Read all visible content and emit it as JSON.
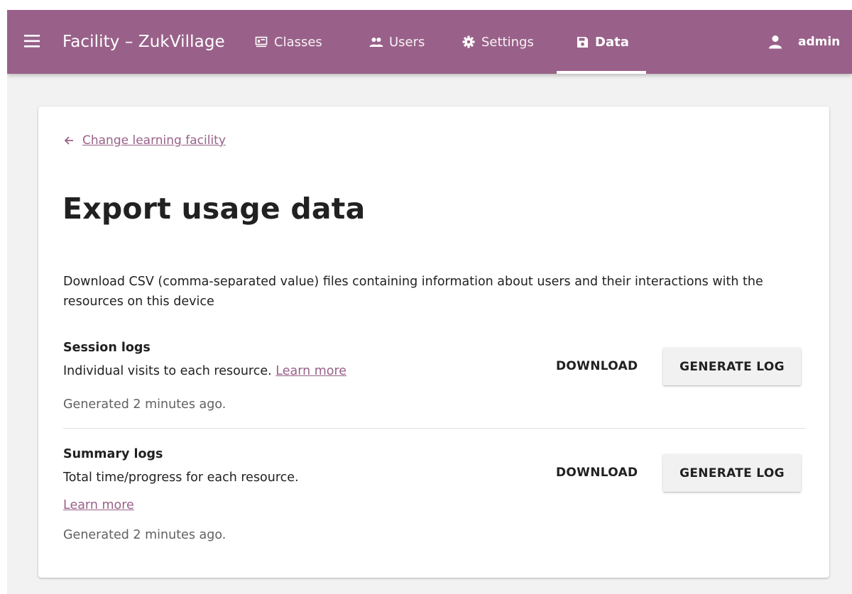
{
  "header": {
    "title": "Facility – ZukVillage",
    "tabs": [
      {
        "label": "Classes",
        "icon": "classes-icon",
        "active": false
      },
      {
        "label": "Users",
        "icon": "users-icon",
        "active": false
      },
      {
        "label": "Settings",
        "icon": "settings-icon",
        "active": false
      },
      {
        "label": "Data",
        "icon": "data-icon",
        "active": true
      }
    ],
    "user": {
      "name": "admin",
      "icon": "person-icon"
    }
  },
  "colors": {
    "brand": "#996189",
    "page_background": "#f2f2f2",
    "card_background": "#ffffff",
    "button_background": "#f1f1f1"
  },
  "main": {
    "back_link": {
      "icon": "arrow-back-icon",
      "label": "Change learning facility"
    },
    "title": "Export usage data",
    "description": "Download CSV (comma-separated value) files containing information about users and their interactions with the resources on this device",
    "sections": [
      {
        "title": "Session logs",
        "description": "Individual visits to each resource.",
        "learn_more": "Learn more",
        "status": "Generated 2 minutes ago.",
        "download_label": "DOWNLOAD",
        "generate_label": "GENERATE LOG"
      },
      {
        "title": "Summary logs",
        "description": "Total time/progress for each resource.",
        "learn_more": "Learn more",
        "status": "Generated 2 minutes ago.",
        "download_label": "DOWNLOAD",
        "generate_label": "GENERATE LOG"
      }
    ]
  }
}
